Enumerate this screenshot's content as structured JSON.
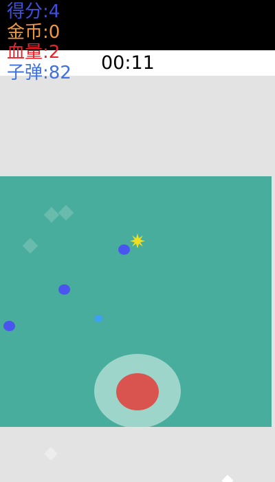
{
  "hud": {
    "score": "得分:4",
    "coins": "金币:0",
    "health": "血量:2",
    "bullets": "子弹:82"
  },
  "timer": "00:11",
  "colors": {
    "score": "#3f4fe0",
    "coins": "#f39a3c",
    "health": "#e8242a",
    "bullets": "#3f70e0",
    "playfield": "#48ad9c",
    "enemy": "#4a55f0",
    "enemy_small": "#3fa0f0",
    "star": "#f0e020",
    "joystick_knob": "#d9534f"
  },
  "icons": {
    "explosion": "star-burst-icon"
  }
}
